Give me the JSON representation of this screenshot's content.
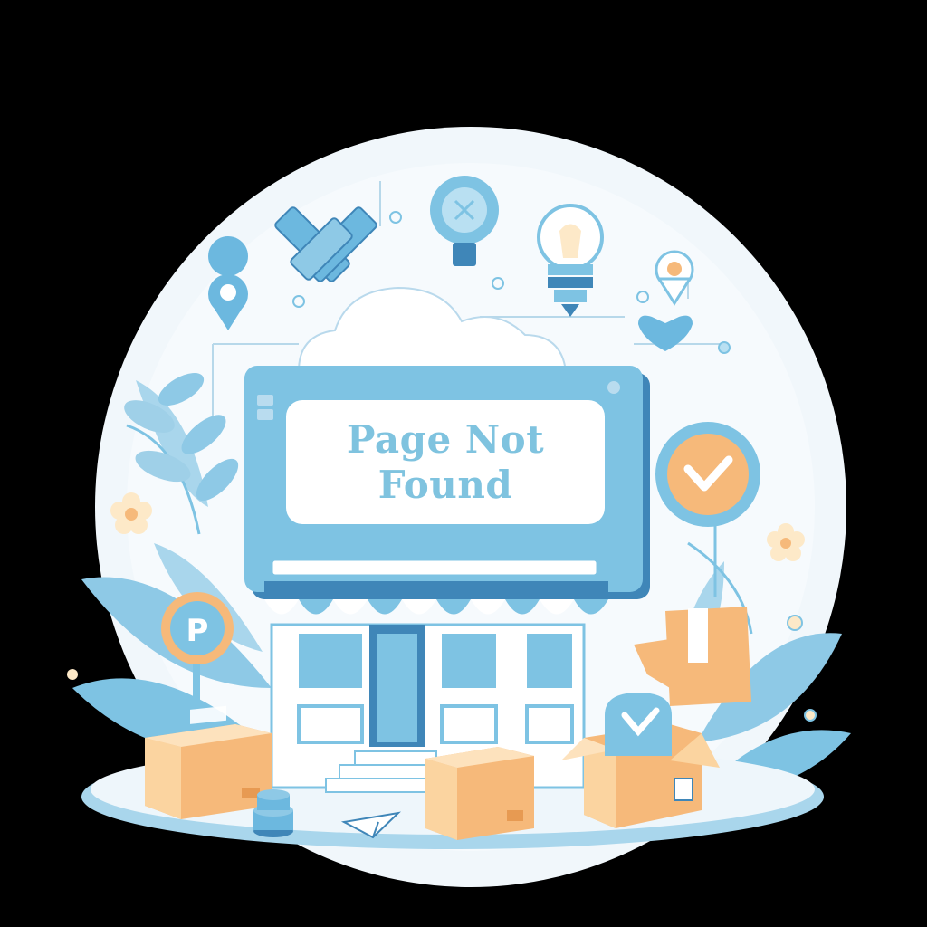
{
  "message": {
    "line1": "Page Not",
    "line2": "Found"
  },
  "sign_letter": "P",
  "colors": {
    "background": "#000000",
    "scene_light": "#eef6fb",
    "primary_blue": "#7ec3e3",
    "dark_blue": "#3f86b8",
    "text_blue": "#7fc3df",
    "box_orange": "#f6b97a",
    "box_light": "#fbd4a0"
  },
  "icons": [
    "map-pin-icon",
    "lightbulb-icon",
    "crossed-tools-icon",
    "heart-icon",
    "checkmark-badge-icon",
    "parking-sign-icon",
    "flower-icon",
    "coin-stack-icon",
    "paper-plane-icon"
  ]
}
